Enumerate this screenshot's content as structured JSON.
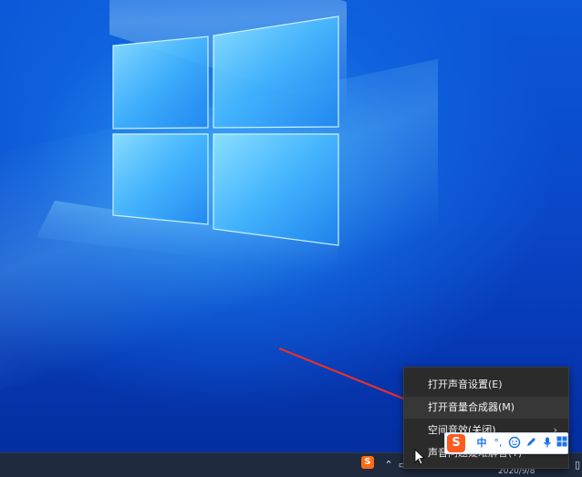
{
  "context_menu": {
    "items": [
      {
        "label": "打开声音设置(E)"
      },
      {
        "label": "打开音量合成器(M)"
      },
      {
        "label": "空间音效(关闭)",
        "chevron": "›"
      },
      {
        "label": "声音问题疑难解答(T)"
      }
    ]
  },
  "ime_toolbar": {
    "logo": "S",
    "mode": "中",
    "punct": "°,",
    "emoji_icon": "emoji-icon",
    "pen_icon": "pen-icon",
    "mic_icon": "microphone-icon",
    "grid_icon": "grid-icon"
  },
  "taskbar": {
    "sogou_label": "S",
    "date": "2020/9/8"
  },
  "colors": {
    "menu_bg": "#2b2b2b",
    "taskbar_bg": "#1f2a3e",
    "arrow": "#e8302a",
    "ime_accent": "#ff5a1f"
  }
}
